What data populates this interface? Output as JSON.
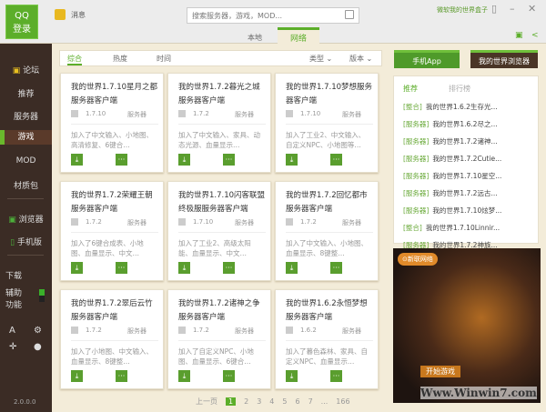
{
  "header": {
    "login_top": "QQ",
    "login_bottom": "登录",
    "message": "消息",
    "search_placeholder": "搜索服务器，游戏，MOD...",
    "user": "微软我的世界盒子",
    "tabs": [
      "本地",
      "网络"
    ],
    "active_tab": "网络"
  },
  "sidebar": {
    "items": [
      "论坛",
      "推荐",
      "服务器",
      "游戏",
      "MOD",
      "材质包",
      "浏览器",
      "手机版",
      "下载",
      "辅助",
      "功能"
    ],
    "active": "游戏",
    "version": "2.0.0.0"
  },
  "filter": {
    "tabs": [
      "综合",
      "热度",
      "时间"
    ],
    "active": "综合",
    "dropdowns": [
      "类型 ⌄",
      "版本 ⌄"
    ]
  },
  "cards": [
    {
      "title": "我的世界1.7.10星月之都服务器客户端",
      "version": "1.7.10",
      "type": "服务器",
      "desc": "加入了中文输入、小地图、高清修复、6键合…"
    },
    {
      "title": "我的世界1.7.2暮光之城服务器客户端",
      "version": "1.7.2",
      "type": "服务器",
      "desc": "加入了中文输入、家具、动态光源、血量显示…"
    },
    {
      "title": "我的世界1.7.10梦想服务器客户端",
      "version": "1.7.10",
      "type": "服务器",
      "desc": "加入了工业2、中文输入、自定义NPC、小地图等…"
    },
    {
      "title": "我的世界1.7.2荣耀王朝服务器客户端",
      "version": "1.7.2",
      "type": "服务器",
      "desc": "加入了6键合成表、小地图、血量显示、中文…"
    },
    {
      "title": "我的世界1.7.10闪客联盟终极服服务器客户端",
      "version": "1.7.10",
      "type": "服务器",
      "desc": "加入了工业2、高级太阳能、血量显示、中文…"
    },
    {
      "title": "我的世界1.7.2回忆都市服务器客户端",
      "version": "1.7.2",
      "type": "服务器",
      "desc": "加入了中文输入、小地图、血量显示、8键整…"
    },
    {
      "title": "我的世界1.7.2翠后云竹服务器客户端",
      "version": "1.7.2",
      "type": "服务器",
      "desc": "加入了小地图、中文输入、血量显示、8键整…"
    },
    {
      "title": "我的世界1.7.2诸神之争服务器客户端",
      "version": "1.7.2",
      "type": "服务器",
      "desc": "加入了自定义NPC、小地图、血量显示、6键合…"
    },
    {
      "title": "我的世界1.6.2永恒梦想服务器客户端",
      "version": "1.6.2",
      "type": "服务器",
      "desc": "加入了暮色森林、家具、自定义NPC、血量显示…"
    }
  ],
  "right": {
    "app_button": "手机App",
    "browser_button": "我的世界浏览器",
    "tabs": [
      "推荐",
      "排行榜"
    ],
    "items": [
      {
        "tag": "[整合]",
        "text": "我的世界1.6.2生存光..."
      },
      {
        "tag": "[服务器]",
        "text": "我的世界1.6.2尽之..."
      },
      {
        "tag": "[服务器]",
        "text": "我的世界1.7.2诸神..."
      },
      {
        "tag": "[服务器]",
        "text": "我的世界1.7.2Cutie..."
      },
      {
        "tag": "[服务器]",
        "text": "我的世界1.7.10星空..."
      },
      {
        "tag": "[服务器]",
        "text": "我的世界1.7.2远古..."
      },
      {
        "tag": "[服务器]",
        "text": "我的世界1.7.10炫梦..."
      },
      {
        "tag": "[整合]",
        "text": "我的世界1.7.10Linnir..."
      },
      {
        "tag": "[服务器]",
        "text": "我的世界1.7.2神族..."
      }
    ],
    "ad": {
      "badge": "⊙新联网络",
      "start": "开始游戏",
      "watermark": "Www.Winwin7.com"
    }
  },
  "pager": {
    "prev": "上一页",
    "pages": [
      "1",
      "2",
      "3",
      "4",
      "5",
      "6",
      "7",
      "...",
      "166"
    ],
    "current": "1"
  },
  "colors": {
    "accent": "#5cae2a",
    "sidebar": "#3b2c25",
    "background": "#f3ecd9"
  }
}
